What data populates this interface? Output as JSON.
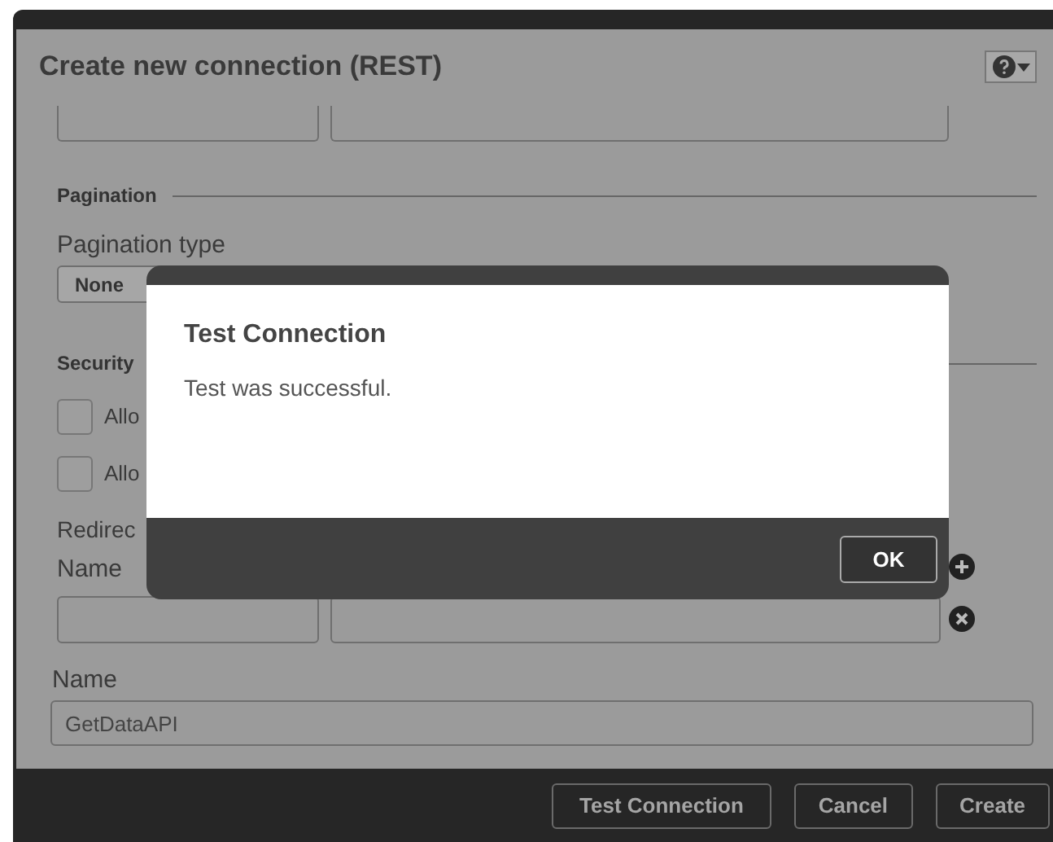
{
  "dialog": {
    "title": "Create new connection (REST)",
    "pagination": {
      "heading": "Pagination",
      "type_label": "Pagination type",
      "type_value": "None"
    },
    "security": {
      "heading": "Security",
      "options": [
        {
          "label": "Allo",
          "checked": false
        },
        {
          "label": "Allo",
          "checked": false
        }
      ]
    },
    "redirect_label": "Redirec",
    "name_column_label": "Name",
    "connection_name": {
      "label": "Name",
      "value": "GetDataAPI"
    },
    "buttons": [
      "Test Connection",
      "Cancel",
      "Create"
    ]
  },
  "modal": {
    "title": "Test Connection",
    "message": "Test was successful.",
    "button": "OK"
  }
}
